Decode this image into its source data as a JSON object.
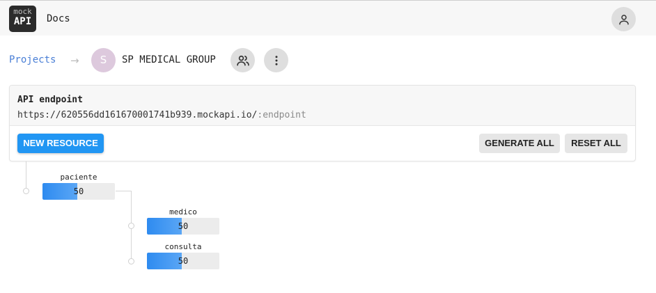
{
  "header": {
    "logo_top": "mock",
    "logo_bottom": "API",
    "docs_label": "Docs"
  },
  "breadcrumb": {
    "projects_label": "Projects",
    "separator": "→",
    "project_initial": "S",
    "project_name": "SP MEDICAL GROUP"
  },
  "endpoint_card": {
    "title": "API endpoint",
    "url_base": "https://620556dd161670001741b939.mockapi.io/",
    "url_suffix": ":endpoint"
  },
  "actions": {
    "new_resource": "NEW RESOURCE",
    "generate_all": "GENERATE ALL",
    "reset_all": "RESET ALL"
  },
  "resources": [
    {
      "name": "paciente",
      "count": "50",
      "fill_fraction": 0.48
    },
    {
      "name": "medico",
      "count": "50",
      "fill_fraction": 0.48
    },
    {
      "name": "consulta",
      "count": "50",
      "fill_fraction": 0.48
    }
  ],
  "colors": {
    "primary": "#2196f3",
    "link": "#4a7fd6",
    "avatar": "#ddc9dd",
    "bar_fill": "#2e8bf0"
  },
  "icons": [
    "user-icon",
    "users-icon",
    "more-vertical-icon",
    "arrow-right-icon"
  ]
}
